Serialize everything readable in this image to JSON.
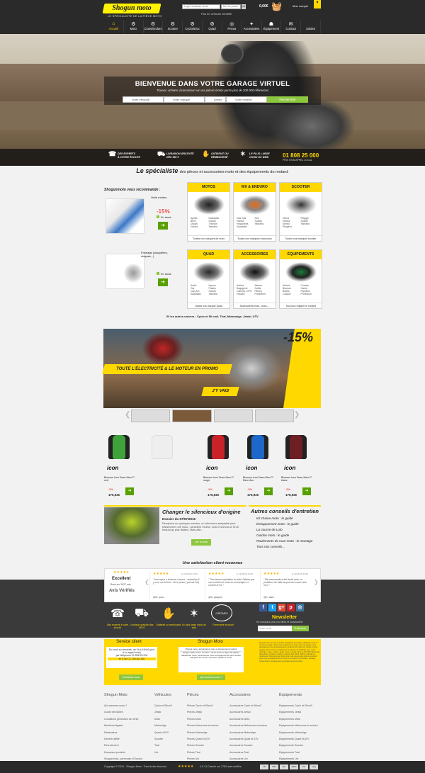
{
  "header": {
    "logo_text": "Shogun moto",
    "tagline": "LE SPÉCIALISTE DE LA PIÈCE MOTO",
    "login_placeholder": "Login / Adresse email",
    "password_placeholder": "Mot de passe",
    "ok_label": "ok",
    "no_vehicle": "Pas de véhicule identifié",
    "cart_amount": "0,00€",
    "account_label": "Mon compte"
  },
  "nav": [
    {
      "label": "Accueil",
      "icon": "⌂"
    },
    {
      "label": "Moto",
      "icon": "⚙"
    },
    {
      "label": "Cross/Enduro",
      "icon": "⚙"
    },
    {
      "label": "Scooter",
      "icon": "⚙"
    },
    {
      "label": "Cyclo/50cc",
      "icon": "⚙"
    },
    {
      "label": "Quad",
      "icon": "⚙"
    },
    {
      "label": "Pneus",
      "icon": "◎"
    },
    {
      "label": "Accessoires",
      "icon": "✦"
    },
    {
      "label": "Équipement",
      "icon": "☗"
    },
    {
      "label": "Contact",
      "icon": "✉"
    },
    {
      "label": "Soldes",
      "icon": ""
    }
  ],
  "hero": {
    "title": "BIENVENUE DANS VOTRE GARAGE VIRTUEL",
    "subtitle": "Trouver, acheter, économiser sur vos pièces motos parmi plus de 200 000 références",
    "selects": [
      "Votre véhicule",
      "Votre marque",
      "Année",
      "Votre modèle"
    ],
    "search_label": "Rechercher"
  },
  "strip": {
    "items": [
      {
        "l1": "DES EXPERTS",
        "l2": "À VOTRE ÉCOUTE",
        "icon": "☎"
      },
      {
        "l1": "LIVRAISON GRATUITE",
        "l2": "DÈS 150 €",
        "icon": "⛟"
      },
      {
        "l1": "SATISFAIT OU",
        "l2": "REMBOURSÉ",
        "icon": "✋"
      },
      {
        "l1": "LE PLUS LARGE",
        "l2": "CHOIX DU WEB",
        "icon": "✶"
      }
    ],
    "phone": "01 808 25 000",
    "phone_sub": "PRIX D'UN APPEL LOCAL"
  },
  "specialist": {
    "lead": "Le spécialiste",
    "rest": "des pièces et accessoires moto et des équipements du motard."
  },
  "recommend": {
    "title": "Shogunmoto vous recommande :",
    "products": [
      {
        "name": "Huile moteur",
        "price": "-15%",
        "stock": "En stock"
      },
      {
        "name": "Freinage (plaquettes, disques...)",
        "price": "",
        "stock": "En stock"
      }
    ],
    "button_icon": "➔"
  },
  "categories": [
    {
      "title": "MOTOS",
      "brands_a": [
        "Aprilia",
        "Bmw",
        "Ducati",
        "Honda"
      ],
      "brands_b": [
        "Kawasaki",
        "Suzuki",
        "Triumph",
        "Yamaha"
      ],
      "footer": "Toutes nos marques de moto"
    },
    {
      "title": "MX & ENDURO",
      "brands_a": [
        "Gas Gas",
        "Honda",
        "Husqvarna",
        "Kawasaki"
      ],
      "brands_b": [
        "Ktm",
        "Suzuki",
        "Yamaha",
        ""
      ],
      "footer": "Toutes nos marques motocross"
    },
    {
      "title": "SCOOTER",
      "brands_a": [
        "Gilera",
        "Honda",
        "Kymco",
        "Peugeot"
      ],
      "brands_b": [
        "Piaggio",
        "Suzuki",
        "Yamaha",
        ""
      ],
      "footer": "Toutes nos marques scooter"
    },
    {
      "title": "QUAD",
      "brands_a": [
        "Arctic",
        "Cat",
        "Can-Am",
        "Kawasaki"
      ],
      "brands_b": [
        "Kymco",
        "Polaris",
        "Suzuki",
        "Yamaha"
      ],
      "footer": "Toutes nos marque Quad"
    },
    {
      "title": "ACCESSOIRES",
      "brands_a": [
        "Antivol",
        "Bagagerie",
        "Caméra, GPS",
        "Housse"
      ],
      "brands_b": [
        "Alarme",
        "Outils",
        "Pièces",
        "Protection"
      ],
      "footer": "Accessoires moto, cross,..."
    },
    {
      "title": "ÉQUIPEMENTS",
      "brands_a": [
        "Antivol",
        "Blouson",
        "Bottes",
        "Casque"
      ],
      "brands_b": [
        "Combis",
        "Gants",
        "Pantalon",
        "Protection"
      ],
      "footer": "Tout pour équiper le motard"
    }
  ],
  "universes": "Et les autres univers : Cyclo et 50 cm3, Trial, Motoneige, Jetski, UTV",
  "promo": {
    "percent": "-15%",
    "text": "TOUTE L'ÉLECTRICITÉ & LE MOTEUR EN PROMO",
    "button": "J'Y VAIS"
  },
  "products": [
    {
      "brand": "icon",
      "name": "Blouson Icon Team Merc™ vert",
      "discount": "-5%",
      "price": "176,92€",
      "color": "#3fa33b"
    },
    {
      "brand": "",
      "name": "",
      "discount": "",
      "price": "",
      "color": "#eeeeee"
    },
    {
      "brand": "icon",
      "name": "Blouson Icon Team Merc™ rouge",
      "discount": "-5%",
      "price": "176,92€",
      "color": "#c9232a"
    },
    {
      "brand": "icon",
      "name": "Blouson Icon Team Merc™ Dino bleu",
      "discount": "-5%",
      "price": "176,92€",
      "color": "#1d68c8"
    },
    {
      "brand": "icon",
      "name": "Blouson Icon Team Merc™ blanc",
      "discount": "-5%",
      "price": "176,92€",
      "color": "#6d1f24"
    }
  ],
  "news": {
    "title": "Changer le silencieux d'origine",
    "date": "Dossier du 07/07/2015",
    "body": "Remplacé en quelques minutes, un silencieux adaptable peut transformer une moto : caractère moteur, look et surtout un bruit beaucoup plus flatteur. Mais atte...",
    "button": "Lire la suite"
  },
  "tips": {
    "title": "Autres conseils d'entretien",
    "items": [
      "Kit chaine moto : le guide",
      "Échappement moto : le guide",
      "La course de Lolo",
      "Guidon moto : le guide",
      "Roulements de roue moto : le montage",
      "Tous nos conseils..."
    ]
  },
  "satisfaction": {
    "title": "Une satisfaction client reconnue",
    "rating_label": "Excellent",
    "rating_sub": "Basé sur 3637 avis",
    "avis": "Avis Vérifiés",
    "reviews": [
      {
        "date": "le 11/06/15 12:53",
        "text": "\" bon rayon a livraison correct , rockrail qu'il y a un sur le bloc.. de le poser ( prévoir etc) \"",
        "author": "@M. jamo"
      },
      {
        "date": "le 11/06/15 10:53",
        "text": "\" Tres bonne réputation du site! J'attens par son modèle de moto en mécanique et conseil et les \"",
        "author": "@M. jacques"
      },
      {
        "date": "le 11/06/15 10:53",
        "text": "\" Me commande a été livrée avec ce problème de taille au premier essai, bien reçu \"",
        "author": "@C. alain"
      }
    ]
  },
  "services": [
    {
      "label": "Des experts à votre écoute",
      "icon": "☎"
    },
    {
      "label": "Livraison gratuite dès 150 €",
      "icon": "⛟"
    },
    {
      "label": "Satisfait ou remboursé",
      "icon": "✋"
    },
    {
      "label": "Le plus large choix du web",
      "icon": "✶"
    }
  ],
  "oscaro": {
    "logo": "OSCARO",
    "label": "Partenaire exclusif"
  },
  "social": [
    {
      "icon": "f",
      "color": "#3b5998"
    },
    {
      "icon": "t",
      "color": "#1da1f2"
    },
    {
      "icon": "g+",
      "color": "#dd4b39"
    },
    {
      "icon": "p",
      "color": "#cb2027"
    },
    {
      "icon": "◎",
      "color": "#3f729b"
    }
  ],
  "newsletter": {
    "title": "Newsletter",
    "sub": "Ne manquez plus nos offres et nouveautés !",
    "placeholder": "Votre email",
    "button": "S'abonner"
  },
  "service_client": {
    "title": "Service client",
    "hours": "Du lundi au vendredi, de 9h à 19h00 (prix d'un appel local)",
    "phone": "par téléphone 01 808 25 000",
    "days": "et 7j sur 7j, 24h sur 24h",
    "button": "Contactez-nous"
  },
  "shogun_moto": {
    "title": "Shogun Moto",
    "sub": "Pièces moto, accessoires moto et équipement motard",
    "body": "Shogun Moto est le numéro 1 de la vente en ligne de pièces détachées moto, accessoires moto et équipements pour toutes marques de motos, scooters, quads et cross.",
    "button": "Qui sommes-nous ?"
  },
  "about": "Shogunmoto.com est le leader spécialiste de la pièce détachée moto et scooter en ligne. Nous vous proposons un large choix de pièces moto, accessoires moto et équipements motard à prix discount. Grâce à notre garage virtuel, trouvez rapidement les pièces compatibles avec votre véhicule : moto, scooter, quad, cross ou cyclo. Plus de 200 000 références disponibles, livraison rapide et gratuite dès 150 € d'achat, satisfait ou remboursé. Notre service client est à votre écoute du lundi au vendredi pour vous conseiller dans le choix de vos pièces d'entretien, freinage, transmission, échappement et équipements du pilote.",
  "footer": {
    "columns": [
      {
        "title": "Shogun Moto",
        "links": [
          "Qui sommes-nous ?",
          "Guide des tailles",
          "Conditions générales de vente",
          "Mentions légales",
          "Partenaires",
          "Devenir affilié",
          "Recrutement",
          "Nouveaux produits",
          "Shogunmoto, partenaire d'Oscaro"
        ]
      },
      {
        "title": "Véhicules",
        "links": [
          "Cyclo et 50cm3",
          "Jetski",
          "Moto",
          "Motoneige",
          "Quad et ATV",
          "Scooter",
          "Trial",
          "Utv"
        ]
      },
      {
        "title": "Pièces",
        "links": [
          "Pièces Cyclo et 50cm3",
          "Pièces Jetski",
          "Pièces Moto",
          "Pièces Motocross et enduro",
          "Pièces Motoneige",
          "Pièces Quad et ATV",
          "Pièces Scooter",
          "Pièces Trial",
          "Pièces Utv"
        ]
      },
      {
        "title": "Accessoires",
        "links": [
          "Accessoires Cyclo et 50cm3",
          "Accessoires Jetski",
          "Accessoires Moto",
          "Accessoires Motocross et enduro",
          "Accessoires Motoneige",
          "Accessoires Quad et ATV",
          "Accessoires Scooter",
          "Accessoires Trial",
          "Accessoires Utv"
        ]
      },
      {
        "title": "Équipements",
        "links": [
          "Équipements Cyclo et 50cm3",
          "Équipements Jetski",
          "Équipements Moto",
          "Équipements Motocross et enduro",
          "Équipements Motoneige",
          "Équipements Quad et ATV",
          "Équipements Scooter",
          "Équipements Trial",
          "Équipements Utv",
          "Équipements Vélo et Sitro"
        ]
      }
    ],
    "copyright": "Copyright © 2015 - Shogun Moto · Tous droits réservés",
    "rating": "4.5 / 5 Calculé sur 1782 avis certifiés",
    "payments": [
      "CB",
      "VISA",
      "MC",
      "AMEX",
      "PP",
      "CHQ"
    ]
  },
  "colors": {
    "accent": "#ffd800",
    "green": "#8dc63f",
    "dark": "#2a2a2a"
  }
}
